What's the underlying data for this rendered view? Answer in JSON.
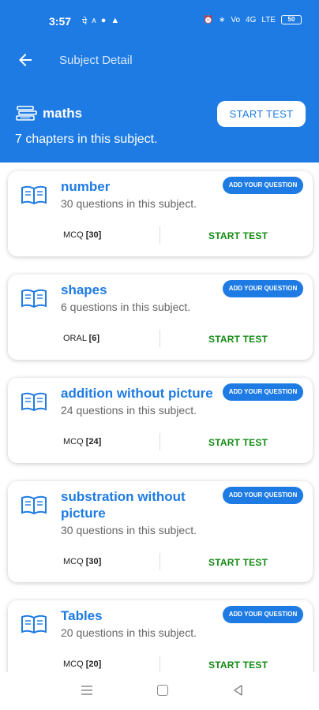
{
  "status": {
    "time": "3:57",
    "left_icons": [
      "पे",
      "ᴀ",
      "●",
      "▲"
    ],
    "right_icons": [
      "⏰",
      "∗",
      "Vo",
      "4G",
      "LTE"
    ],
    "battery": "50"
  },
  "header": {
    "title": "Subject Detail",
    "subject_name": "maths",
    "chapter_count": "7 chapters in this subject.",
    "start_test_label": "START TEST"
  },
  "chapters": [
    {
      "title": "number",
      "subtitle": "30 questions in this subject.",
      "add_label": "ADD YOUR QUESTION",
      "type": "MCQ",
      "count": "[30]",
      "start_label": "START TEST"
    },
    {
      "title": "shapes",
      "subtitle": "6 questions in this subject.",
      "add_label": "ADD YOUR QUESTION",
      "type": "ORAL",
      "count": "[6]",
      "start_label": "START TEST"
    },
    {
      "title": "addition without picture",
      "subtitle": "24 questions in this subject.",
      "add_label": "ADD YOUR QUESTION",
      "type": "MCQ",
      "count": "[24]",
      "start_label": "START TEST"
    },
    {
      "title": "substration without picture",
      "subtitle": "30 questions in this subject.",
      "add_label": "ADD YOUR QUESTION",
      "type": "MCQ",
      "count": "[30]",
      "start_label": "START TEST"
    },
    {
      "title": "Tables",
      "subtitle": "20 questions in this subject.",
      "add_label": "ADD YOUR QUESTION",
      "type": "MCQ",
      "count": "[20]",
      "start_label": "START TEST"
    }
  ],
  "colors": {
    "primary": "#1e7be3",
    "start_green": "#138a13",
    "subtitle_gray": "#666666"
  },
  "icons": [
    "back-arrow-icon",
    "books-icon",
    "book-open-icon",
    "menu-icon",
    "home-icon",
    "back-triangle-icon"
  ]
}
